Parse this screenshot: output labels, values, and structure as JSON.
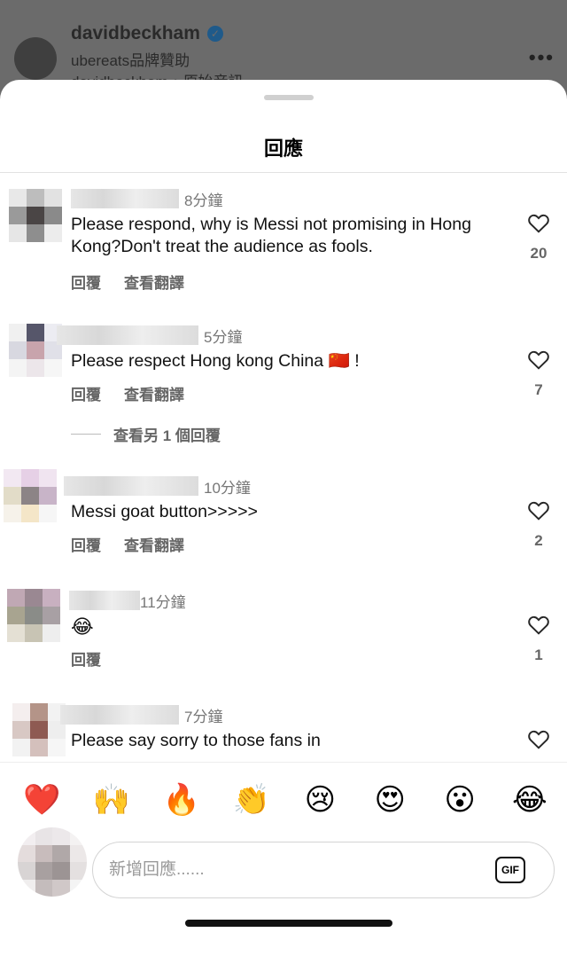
{
  "post": {
    "username": "davidbeckham",
    "sponsor_line": "ubereats品牌贊助",
    "audio_line": "davidbeckham・原始音訊",
    "more_label": "•••"
  },
  "sheet": {
    "title": "回應"
  },
  "comments": [
    {
      "time": "8分鐘",
      "text": "Please respond, why is Messi not promising in Hong Kong?Don't treat the audience as fools.",
      "reply": "回覆",
      "translate": "查看翻譯",
      "likes": "20"
    },
    {
      "time": "5分鐘",
      "text": "Please respect Hong kong China 🇨🇳 !",
      "reply": "回覆",
      "translate": "查看翻譯",
      "likes": "7",
      "view_replies": "查看另 1 個回覆"
    },
    {
      "time": "10分鐘",
      "text": "Messi goat button>>>>>",
      "reply": "回覆",
      "translate": "查看翻譯",
      "likes": "2"
    },
    {
      "time": "11分鐘",
      "text": "😂",
      "reply": "回覆",
      "likes": "1"
    },
    {
      "time": "7分鐘",
      "text": "Please say sorry to those fans in"
    }
  ],
  "emoji_bar": [
    "❤️",
    "🙌",
    "🔥",
    "👏",
    "😢",
    "😍",
    "😮",
    "😂"
  ],
  "composer": {
    "placeholder": "新增回應......",
    "gif_label": "GIF"
  }
}
